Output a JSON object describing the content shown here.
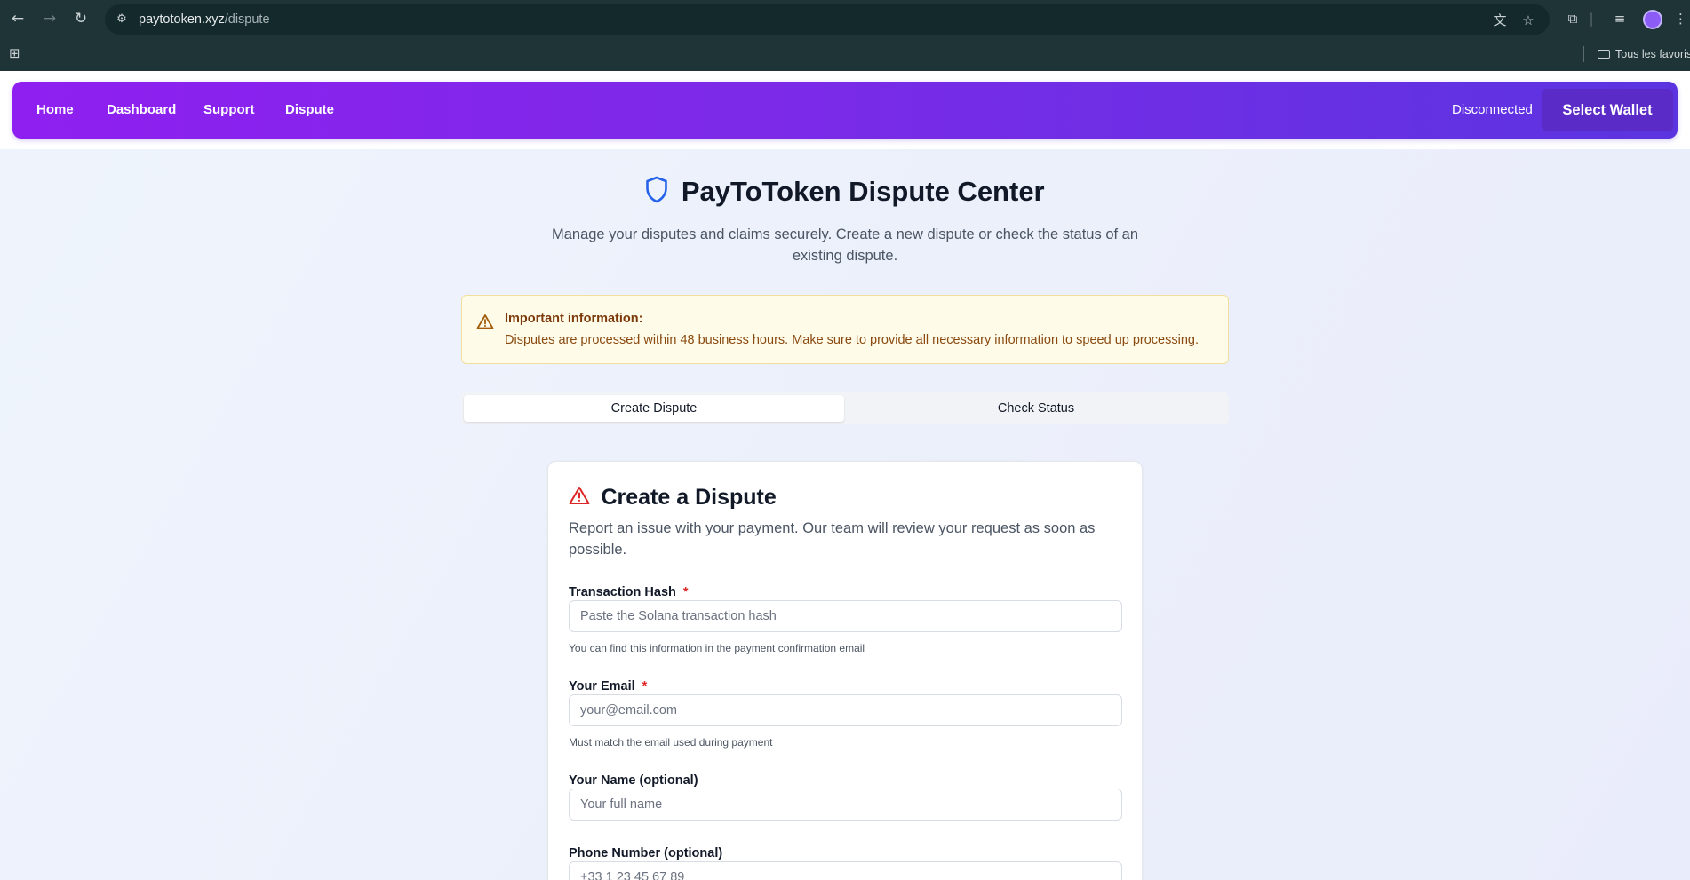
{
  "browser": {
    "url_host": "paytotoken.xyz",
    "url_path": "/dispute",
    "bookmarks_folder": "Tous les favoris"
  },
  "site_nav": {
    "links": [
      "Home",
      "Dashboard",
      "Support",
      "Dispute"
    ],
    "status": "Disconnected",
    "wallet_button": "Select Wallet"
  },
  "page": {
    "title": "PayToToken Dispute Center",
    "subtitle": "Manage your disputes and claims securely. Create a new dispute or check the status of an existing dispute."
  },
  "info": {
    "title": "Important information:",
    "text": "Disputes are processed within 48 business hours. Make sure to provide all necessary information to speed up processing."
  },
  "tabs": [
    {
      "label": "Create Dispute",
      "active": true
    },
    {
      "label": "Check Status",
      "active": false
    }
  ],
  "form": {
    "title": "Create a Dispute",
    "description": "Report an issue with your payment. Our team will review your request as soon as possible.",
    "fields": [
      {
        "label": "Transaction Hash",
        "required": "*",
        "placeholder": "Paste the Solana transaction hash",
        "hint": "You can find this information in the payment confirmation email"
      },
      {
        "label": "Your Email",
        "required": "*",
        "placeholder": "your@email.com",
        "hint": "Must match the email used during payment"
      },
      {
        "label": "Your Name (optional)",
        "placeholder": "Your full name"
      },
      {
        "label": "Phone Number (optional)",
        "placeholder": "+33 1 23 45 67 89"
      }
    ]
  },
  "colors": {
    "nav_gradient_start": "#8f1ff0",
    "nav_gradient_end": "#5b34e0",
    "wallet_button": "#5b2bc7",
    "shield_icon": "#2563eb",
    "warning_icon": "#dc2626",
    "info_border": "#f1df9b",
    "info_background": "#fefbe9"
  },
  "icons": {
    "back": "arrow-left-icon",
    "forward": "arrow-right-icon",
    "reload": "reload-icon",
    "site_info": "tune-icon",
    "translate": "translate-icon",
    "bookmark": "star-icon",
    "extensions": "puzzle-icon",
    "media": "playlist-icon",
    "apps": "apps-grid-icon",
    "folder": "folder-icon",
    "title": "shield-icon",
    "info": "warning-triangle-icon",
    "form_title": "alert-triangle-icon"
  }
}
